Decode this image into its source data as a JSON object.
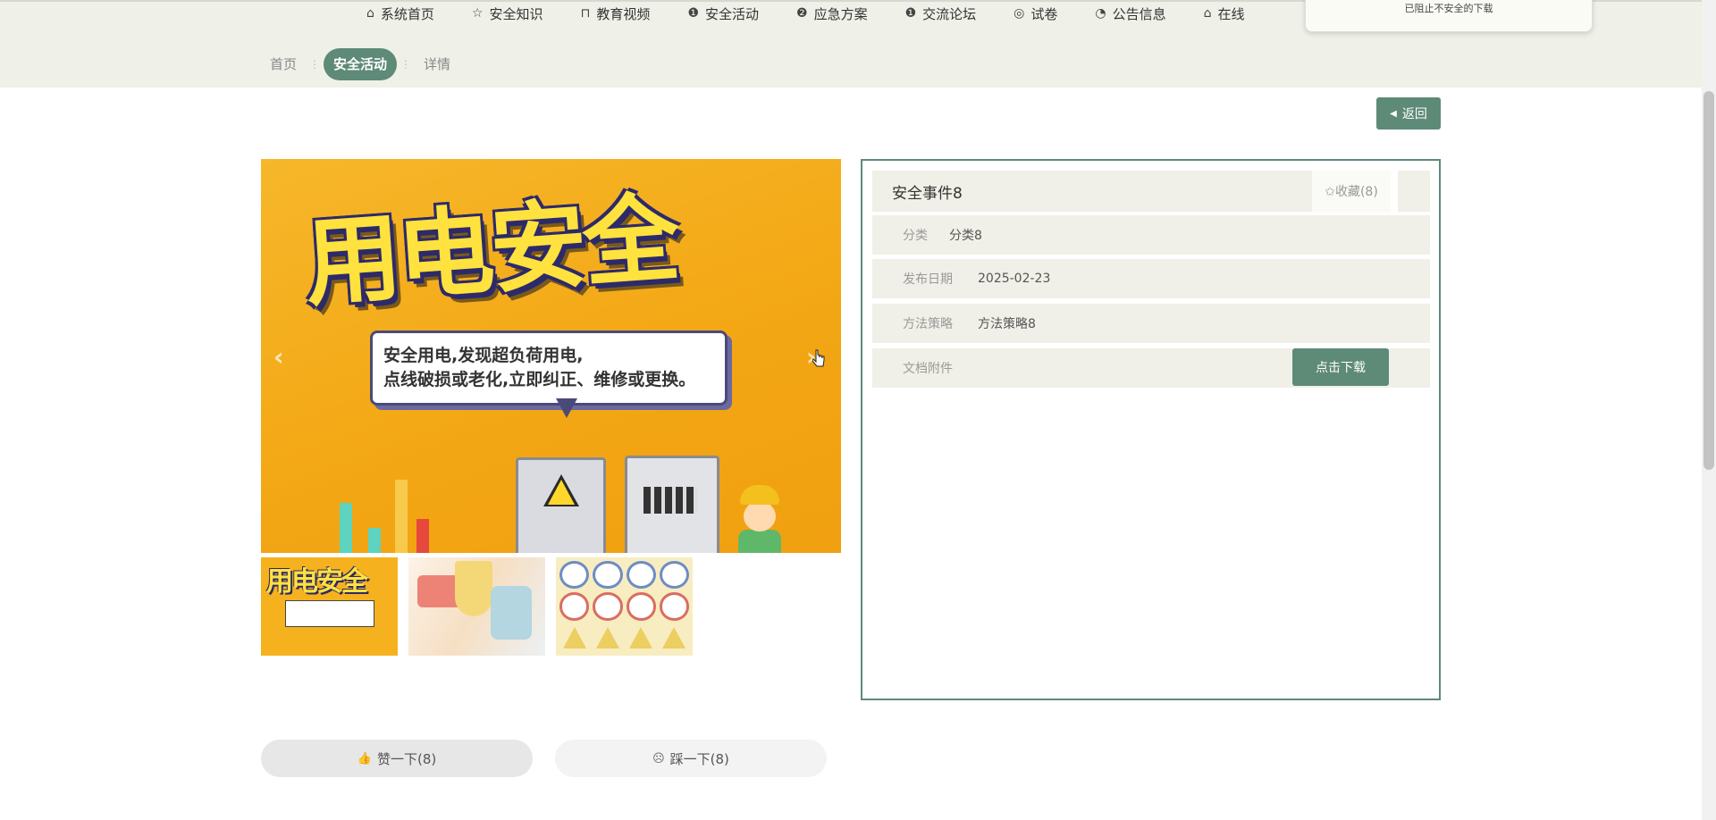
{
  "nav": {
    "items": [
      {
        "icon": "⌂",
        "label": "系统首页"
      },
      {
        "icon": "☆",
        "label": "安全知识"
      },
      {
        "icon": "⊓",
        "label": "教育视频"
      },
      {
        "icon": "❶",
        "label": "安全活动"
      },
      {
        "icon": "❷",
        "label": "应急方案"
      },
      {
        "icon": "❶",
        "label": "交流论坛"
      },
      {
        "icon": "◎",
        "label": "试卷"
      },
      {
        "icon": "◔",
        "label": "公告信息"
      },
      {
        "icon": "⌂",
        "label": "在线"
      }
    ]
  },
  "toast": {
    "text": "已阻止不安全的下载"
  },
  "breadcrumb": {
    "home": "首页",
    "activity": "安全活动",
    "detail": "详情",
    "sep": "⋮"
  },
  "back_button": {
    "label": "返回",
    "icon": "◀"
  },
  "carousel": {
    "main_title": "用电安全",
    "bubble_line1": "安全用电,发现超负荷用电,",
    "bubble_line2": "点线破损或老化,立即纠正、维修或更换。",
    "prev_glyph": "‹",
    "next_glyph": "›"
  },
  "detail": {
    "title": "安全事件8",
    "favorite": "✩收藏(8)",
    "category_label": "分类",
    "category_value": "分类8",
    "date_label": "发布日期",
    "date_value": "2025-02-23",
    "method_label": "方法策略",
    "method_value": "方法策略8",
    "attachment_label": "文档附件",
    "download_label": "点击下载"
  },
  "votes": {
    "like_label": "赞一下(8)",
    "like_icon": "👍",
    "dislike_label": "踩一下(8)",
    "dislike_icon": "☹"
  },
  "colors": {
    "accent": "#5e8a78",
    "header_bg": "#eff0e8",
    "row_bg": "#f0f0e8"
  }
}
